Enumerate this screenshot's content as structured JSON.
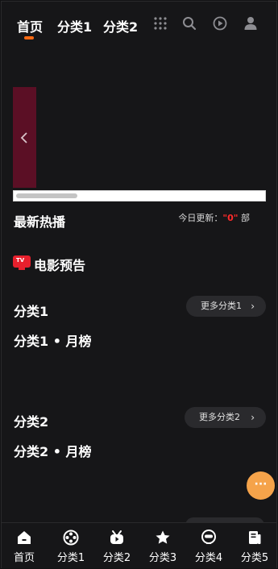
{
  "top_nav": {
    "tabs": [
      {
        "label": "首页",
        "active": true
      },
      {
        "label": "分类1",
        "active": false
      },
      {
        "label": "分类2",
        "active": false
      }
    ],
    "icons": [
      "grid-icon",
      "search-icon",
      "play-circle-icon",
      "user-icon"
    ]
  },
  "banner": {
    "prev_icon": "chevron-left-icon"
  },
  "latest": {
    "title": "最新热播",
    "update_prefix": "今日更新：",
    "update_count": "\"0\"",
    "update_suffix": " 部"
  },
  "movie_preview": {
    "badge": "TV",
    "label": "电影预告"
  },
  "category1": {
    "title": "分类1",
    "more": "更多分类1",
    "subtitle": "分类1 • 月榜"
  },
  "category2": {
    "title": "分类2",
    "more": "更多分类2",
    "subtitle": "分类2 • 月榜"
  },
  "fab": {
    "glyph": "···"
  },
  "bottom_nav": [
    {
      "label": "首页",
      "icon": "home-icon"
    },
    {
      "label": "分类1",
      "icon": "film-reel-icon"
    },
    {
      "label": "分类2",
      "icon": "tv-icon"
    },
    {
      "label": "分类3",
      "icon": "star-icon"
    },
    {
      "label": "分类4",
      "icon": "robot-icon"
    },
    {
      "label": "分类5",
      "icon": "book-icon"
    }
  ],
  "colors": {
    "accent": "#ff6a13",
    "background": "#161618",
    "highlight_red": "#ff2a2a",
    "fab": "#f5a34a"
  }
}
